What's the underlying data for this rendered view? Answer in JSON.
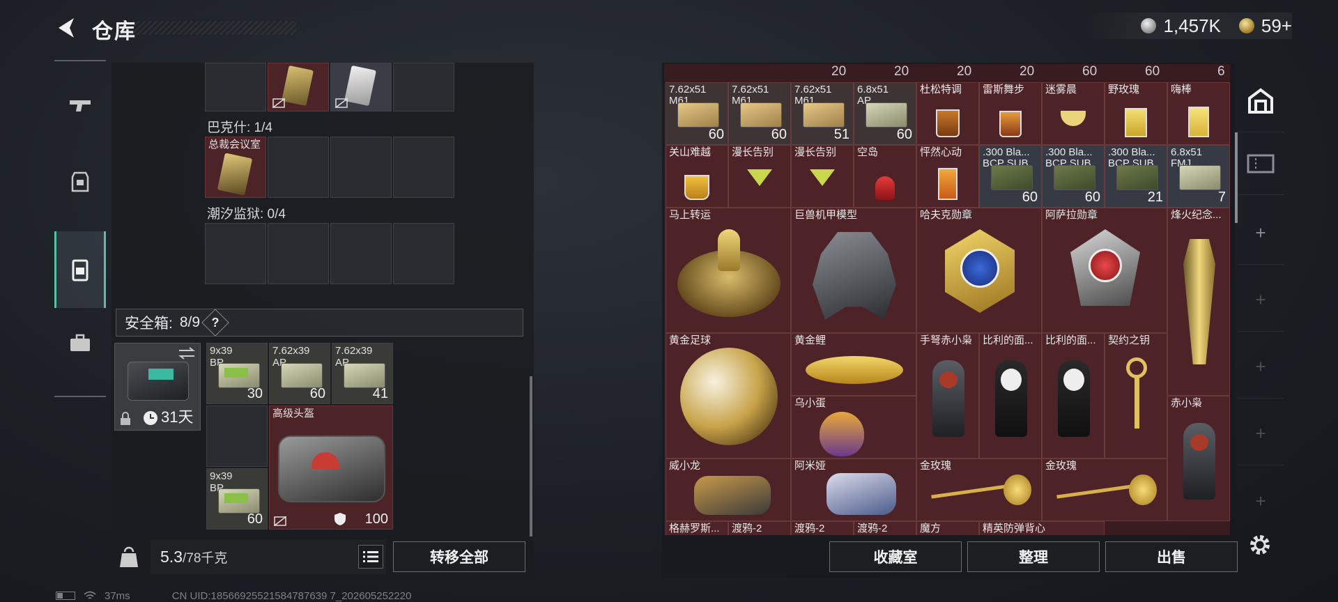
{
  "header": {
    "title": "仓库",
    "currency_silver": "1,457K",
    "currency_gold": "59+"
  },
  "left_panel": {
    "section_bakeshi": "巴克什: 1/4",
    "section_zongcai_item": "总裁会议室",
    "section_chaoxi": "潮汐监狱: 0/4",
    "safe_box": {
      "label": "安全箱:",
      "count": "8/9",
      "help": "?",
      "days": "31天"
    },
    "safe_items": [
      {
        "label": "9x39\nBP",
        "count": "30"
      },
      {
        "label": "7.62x39\nAP",
        "count": "60"
      },
      {
        "label": "7.62x39\nAP",
        "count": "41"
      },
      {
        "label": "高级头盔",
        "count": "100"
      },
      {
        "label": "9x39\nBP",
        "count": "60"
      }
    ]
  },
  "bottom_left": {
    "weight_value": "5.3",
    "weight_cap": "/78千克",
    "transfer_all": "转移全部"
  },
  "stash": {
    "top_counts": [
      "20",
      "20",
      "20",
      "20",
      "60",
      "60",
      "6"
    ],
    "row1": [
      {
        "label": "7.62x51\nM61",
        "count": "60"
      },
      {
        "label": "7.62x51\nM61",
        "count": "60"
      },
      {
        "label": "7.62x51\nM61",
        "count": "51"
      },
      {
        "label": "6.8x51\nAP",
        "count": "60"
      },
      {
        "label": "杜松特调",
        "count": ""
      },
      {
        "label": "雷斯舞步",
        "count": ""
      },
      {
        "label": "迷雾晨",
        "count": ""
      },
      {
        "label": "野玫瑰",
        "count": ""
      },
      {
        "label": "嗨棒",
        "count": ""
      }
    ],
    "row2": [
      {
        "label": "关山难越",
        "count": ""
      },
      {
        "label": "漫长告别",
        "count": ""
      },
      {
        "label": "漫长告别",
        "count": ""
      },
      {
        "label": "空岛",
        "count": ""
      },
      {
        "label": "怦然心动",
        "count": ""
      },
      {
        "label": ".300 Bla...\nBCP SUB",
        "count": "60"
      },
      {
        "label": ".300 Bla...\nBCP SUB",
        "count": "60"
      },
      {
        "label": ".300 Bla...\nBCP SUB",
        "count": "21"
      },
      {
        "label": "6.8x51\nFMJ",
        "count": "7"
      }
    ],
    "big_items": {
      "mashang": "马上转运",
      "jushou": "巨兽机甲模型",
      "hafuke": "哈夫克勋章",
      "asala": "阿萨拉勋章",
      "fenghuo": "烽火纪念...",
      "huangjin_zuqiu": "黄金足球",
      "huangjin_li": "黄金鲤",
      "shounu": "手弩赤小枭",
      "bili1": "比利的面...",
      "bili2": "比利的面...",
      "qiyue": "契约之钥",
      "wuxiaodan": "乌小蛋",
      "chixiaoxiao": "赤小枭",
      "weixiaolong": "威小龙",
      "amiya": "阿米娅",
      "jinmeigui1": "金玫瑰",
      "jinmeigui2": "金玫瑰"
    },
    "bottom_row": [
      "格赫罗斯...",
      "渡鸦-2",
      "渡鸦-2",
      "渡鸦-2",
      "魔方",
      "精英防弹背心"
    ]
  },
  "bottom_right": {
    "collection": "收藏室",
    "organize": "整理",
    "sell": "出售"
  },
  "footer": {
    "ping": "37ms",
    "uid": "CN UID:18566925521584787639 7_202605252220"
  },
  "colors": {
    "accent_teal": "#56c2a2",
    "item_red": "#4e2327",
    "panel_dark": "#1a1c20"
  },
  "icons": [
    "back-arrow-icon",
    "gun-icon",
    "armor-icon",
    "backpack-icon",
    "case-icon",
    "stash-house-icon",
    "ticket-icon",
    "plus-icon",
    "gear-icon",
    "list-icon",
    "weight-icon",
    "lock-icon",
    "clock-icon",
    "shield-icon",
    "swap-icon",
    "wifi-icon",
    "battery-icon"
  ]
}
